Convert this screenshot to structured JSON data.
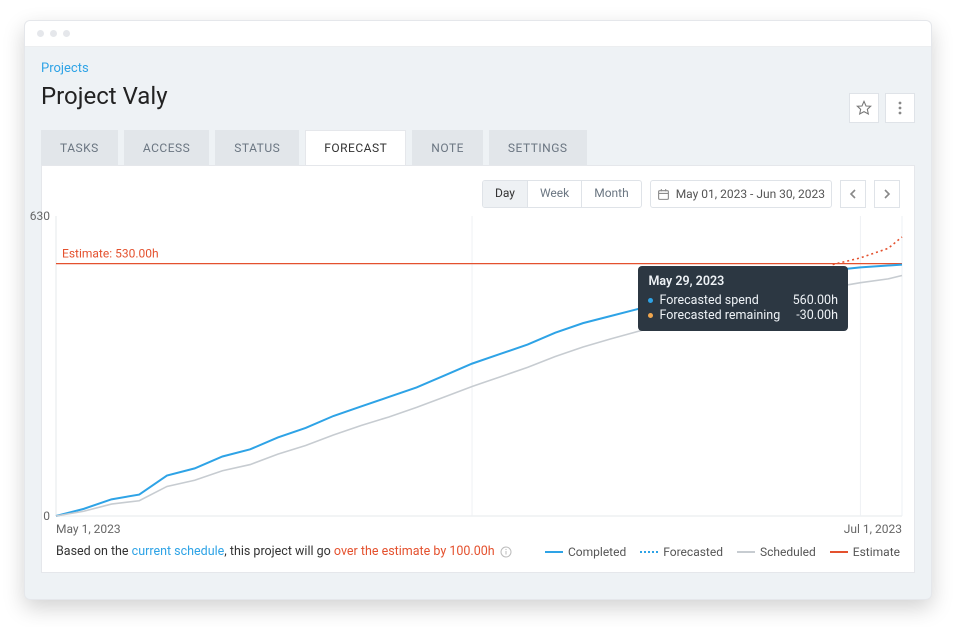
{
  "breadcrumb": "Projects",
  "title": "Project Valy",
  "tabs": [
    "TASKS",
    "ACCESS",
    "STATUS",
    "FORECAST",
    "NOTE",
    "SETTINGS"
  ],
  "active_tab": 3,
  "granularity": {
    "options": [
      "Day",
      "Week",
      "Month"
    ],
    "selected": "Day"
  },
  "date_range": "May 01, 2023 - Jun 30, 2023",
  "y_max_label": "630",
  "y_min_label": "0",
  "x_start": "May 1, 2023",
  "x_end": "Jul 1, 2023",
  "estimate_label": "Estimate: 530.00h",
  "tooltip": {
    "date": "May 29, 2023",
    "rows": [
      {
        "color": "#2ea3e6",
        "label": "Forecasted spend",
        "value": "560.00h"
      },
      {
        "color": "#f0a64e",
        "label": "Forecasted remaining",
        "value": "-30.00h"
      }
    ]
  },
  "footer_msg": {
    "pre": "Based on the ",
    "sched": "current schedule",
    "mid": ", this project will go ",
    "over": "over the estimate by 100.00h"
  },
  "legend": [
    {
      "name": "Completed",
      "swatch": "solid",
      "color": "#2ea3e6"
    },
    {
      "name": "Forecasted",
      "swatch": "dotted",
      "color": "#2ea3e6"
    },
    {
      "name": "Scheduled",
      "swatch": "solid",
      "color": "#c7ccd1"
    },
    {
      "name": "Estimate",
      "swatch": "solid",
      "color": "#e4512e"
    }
  ],
  "colors": {
    "completed": "#2ea3e6",
    "scheduled": "#c7ccd1",
    "estimate": "#e4512e"
  },
  "chart_data": {
    "type": "line",
    "xlabel": "",
    "ylabel": "",
    "ylim": [
      0,
      630
    ],
    "xlim": [
      "2023-05-01",
      "2023-07-01"
    ],
    "estimate": 530,
    "x_days": [
      0,
      2,
      4,
      6,
      8,
      10,
      12,
      14,
      16,
      18,
      20,
      22,
      24,
      26,
      28,
      30,
      32,
      34,
      36,
      38,
      40,
      42,
      44,
      46,
      48,
      50,
      52,
      54,
      56,
      58,
      60,
      61
    ],
    "series": [
      {
        "name": "Completed",
        "color": "#2ea3e6",
        "style": "solid",
        "values": [
          0,
          15,
          35,
          45,
          85,
          100,
          125,
          140,
          165,
          185,
          210,
          230,
          250,
          270,
          295,
          320,
          340,
          360,
          385,
          405,
          420,
          435,
          450,
          465,
          478,
          490,
          500,
          508,
          516,
          522,
          526,
          528
        ]
      },
      {
        "name": "Scheduled",
        "color": "#c7ccd1",
        "style": "solid",
        "values": [
          0,
          10,
          25,
          32,
          62,
          75,
          95,
          108,
          130,
          148,
          170,
          190,
          208,
          228,
          250,
          272,
          292,
          312,
          335,
          355,
          372,
          388,
          404,
          420,
          434,
          448,
          460,
          470,
          480,
          490,
          498,
          505
        ]
      },
      {
        "name": "Forecasted",
        "color": "#e4512e",
        "style": "dotted",
        "values": [
          null,
          null,
          null,
          null,
          null,
          null,
          null,
          null,
          null,
          null,
          null,
          null,
          null,
          null,
          null,
          null,
          null,
          null,
          null,
          null,
          null,
          null,
          null,
          null,
          null,
          null,
          null,
          null,
          528,
          542,
          562,
          586
        ]
      },
      {
        "name": "Estimate",
        "color": "#e4512e",
        "style": "solid",
        "values": [
          530,
          530,
          530,
          530,
          530,
          530,
          530,
          530,
          530,
          530,
          530,
          530,
          530,
          530,
          530,
          530,
          530,
          530,
          530,
          530,
          530,
          530,
          530,
          530,
          530,
          530,
          530,
          530,
          530,
          530,
          530,
          530
        ]
      }
    ]
  }
}
